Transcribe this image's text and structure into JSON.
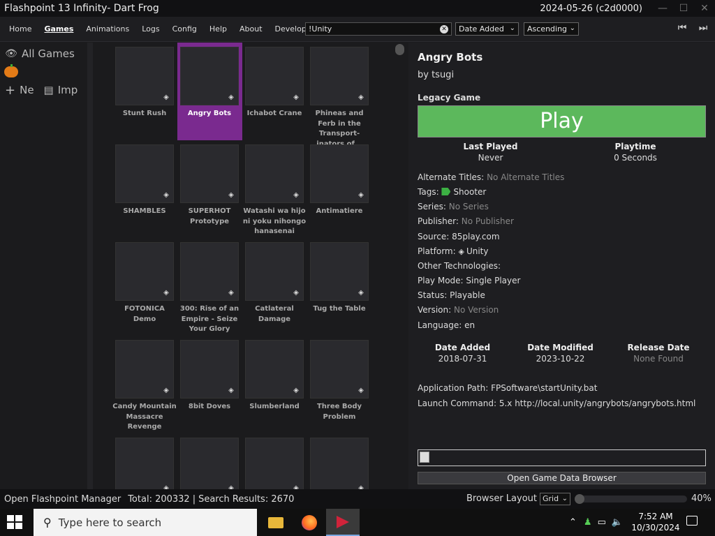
{
  "window": {
    "title": "Flashpoint 13 Infinity- Dart Frog",
    "version": "2024-05-26 (c2d0000)"
  },
  "menu": {
    "items": [
      {
        "label": "Home"
      },
      {
        "label": "Games"
      },
      {
        "label": "Animations"
      },
      {
        "label": "Logs"
      },
      {
        "label": "Config"
      },
      {
        "label": "Help"
      },
      {
        "label": "About"
      },
      {
        "label": "Developer"
      }
    ],
    "active": "Games",
    "search_value": "!Unity",
    "sort_field": "Date Added",
    "sort_order": "Ascending"
  },
  "sidebar": {
    "all_games": "All Games",
    "new_label": "Ne",
    "import_label": "Imp"
  },
  "games": [
    {
      "title": "Stunt Rush"
    },
    {
      "title": "Angry Bots",
      "selected": true
    },
    {
      "title": "Ichabot Crane"
    },
    {
      "title": "Phineas and Ferb in the Transport-inators of..."
    },
    {
      "title": "SHAMBLES"
    },
    {
      "title": "SUPERHOT Prototype"
    },
    {
      "title": "Watashi wa hijo ni yoku nihongo hanasenai"
    },
    {
      "title": "Antimatiere"
    },
    {
      "title": "FOTONICA Demo"
    },
    {
      "title": "300: Rise of an Empire - Seize Your Glory"
    },
    {
      "title": "Catlateral Damage"
    },
    {
      "title": "Tug the Table"
    },
    {
      "title": "Candy Mountain Massacre Revenge"
    },
    {
      "title": "8bit Doves"
    },
    {
      "title": "Slumberland"
    },
    {
      "title": "Three Body Problem"
    },
    {
      "title": ""
    },
    {
      "title": ""
    },
    {
      "title": ""
    },
    {
      "title": ""
    }
  ],
  "details": {
    "title": "Angry Bots",
    "by": "by tsugi",
    "legacy": "Legacy Game",
    "play_label": "Play",
    "last_played_label": "Last Played",
    "last_played_value": "Never",
    "playtime_label": "Playtime",
    "playtime_value": "0 Seconds",
    "fields": {
      "alt_titles_label": "Alternate Titles:",
      "alt_titles_value": "No Alternate Titles",
      "tags_label": "Tags:",
      "tags_value": "Shooter",
      "series_label": "Series:",
      "series_value": "No Series",
      "publisher_label": "Publisher:",
      "publisher_value": "No Publisher",
      "source_label": "Source:",
      "source_value": "85play.com",
      "platform_label": "Platform:",
      "platform_value": "Unity",
      "other_tech_label": "Other Technologies:",
      "play_mode_label": "Play Mode:",
      "play_mode_value": "Single Player",
      "status_label": "Status:",
      "status_value": "Playable",
      "version_label": "Version:",
      "version_value": "No Version",
      "language_label": "Language:",
      "language_value": "en"
    },
    "dates": {
      "added_label": "Date Added",
      "added_value": "2018-07-31",
      "modified_label": "Date Modified",
      "modified_value": "2023-10-22",
      "release_label": "Release Date",
      "release_value": "None Found"
    },
    "app_path_label": "Application Path:",
    "app_path_value": "FPSoftware\\startUnity.bat",
    "launch_label": "Launch Command:",
    "launch_value": "5.x http://local.unity/angrybots/angrybots.html",
    "data_browser_label": "Open Game Data Browser"
  },
  "status": {
    "manager": "Open Flashpoint Manager",
    "total": "Total: 200332",
    "separator": "|",
    "results": "Search Results: 2670",
    "layout_label": "Browser Layout",
    "layout_value": "Grid",
    "zoom": "40%"
  },
  "taskbar": {
    "search_placeholder": "Type here to search",
    "time": "7:52 AM",
    "date": "10/30/2024"
  }
}
